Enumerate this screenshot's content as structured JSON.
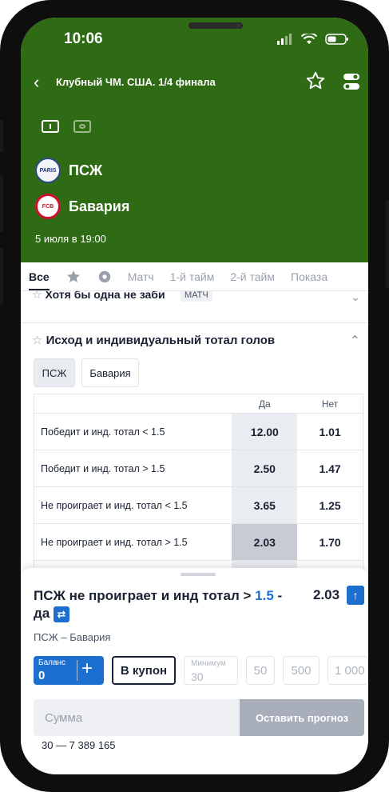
{
  "status": {
    "time": "10:06"
  },
  "header": {
    "title": "Клубный ЧМ. США. 1/4 финала",
    "team_home": "ПСЖ",
    "team_away": "Бавария",
    "crest_home": "PARIS",
    "crest_away": "FCB",
    "date": "5 июля в 19:00",
    "colors": {
      "header_bg": "#2f6b14",
      "accent": "#1c6ecf"
    }
  },
  "tabs": [
    "Все",
    "Матч",
    "1-й тайм",
    "2-й тайм",
    "Показа"
  ],
  "cut_market": {
    "title": "Хотя бы одна не заби",
    "badge": "МАТЧ"
  },
  "market": {
    "title": "Исход и индивидуальный тотал голов",
    "chips": [
      "ПСЖ",
      "Бавария"
    ],
    "columns": [
      "Да",
      "Нет"
    ],
    "rows": [
      {
        "label": "Победит и инд. тотал < 1.5",
        "yes": "12.00",
        "no": "1.01"
      },
      {
        "label": "Победит и инд. тотал > 1.5",
        "yes": "2.50",
        "no": "1.47"
      },
      {
        "label": "Не проиграет и инд. тотал < 1.5",
        "yes": "3.65",
        "no": "1.25"
      },
      {
        "label": "Не проиграет и инд. тотал > 1.5",
        "yes": "2.03",
        "no": "1.70"
      }
    ]
  },
  "bet": {
    "title_prefix": "ПСЖ не проиграет и инд тотал > ",
    "title_value": "1.5",
    "title_suffix": " - да",
    "odd": "2.03",
    "match": "ПСЖ – Бавария",
    "balance_label": "Баланс",
    "balance_value": "0",
    "coupon_label": "В купон",
    "min_label": "Минимум",
    "min_value": "30",
    "quick_amounts": [
      "50",
      "500",
      "1 000"
    ],
    "amount_placeholder": "Сумма",
    "submit_label": "Оставить прогноз",
    "range": "30 — 7 389 165"
  }
}
